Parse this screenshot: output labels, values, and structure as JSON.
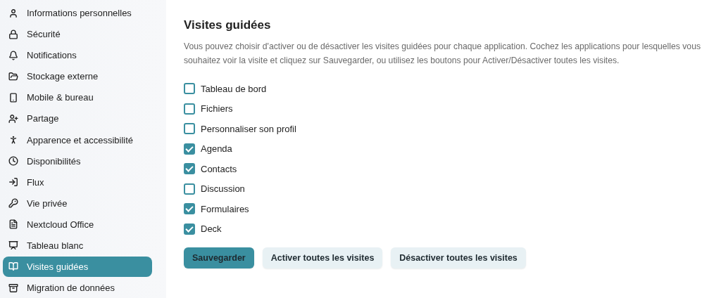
{
  "sidebar": {
    "items": [
      {
        "label": "Informations personnelles",
        "selected": false
      },
      {
        "label": "Sécurité",
        "selected": false
      },
      {
        "label": "Notifications",
        "selected": false
      },
      {
        "label": "Stockage externe",
        "selected": false
      },
      {
        "label": "Mobile & bureau",
        "selected": false
      },
      {
        "label": "Partage",
        "selected": false
      },
      {
        "label": "Apparence et accessibilité",
        "selected": false
      },
      {
        "label": "Disponibilités",
        "selected": false
      },
      {
        "label": "Flux",
        "selected": false
      },
      {
        "label": "Vie privée",
        "selected": false
      },
      {
        "label": "Nextcloud Office",
        "selected": false
      },
      {
        "label": "Tableau blanc",
        "selected": false
      },
      {
        "label": "Visites guidées",
        "selected": true
      },
      {
        "label": "Migration de données",
        "selected": false
      }
    ]
  },
  "main": {
    "title": "Visites guidées",
    "description": "Vous pouvez choisir d'activer ou de désactiver les visites guidées pour chaque application. Cochez les applications pour lesquelles vous souhaitez voir la visite et cliquez sur Sauvegarder, ou utilisez les boutons pour Activer/Désactiver toutes les visites.",
    "apps": [
      {
        "label": "Tableau de bord",
        "checked": false
      },
      {
        "label": "Fichiers",
        "checked": false
      },
      {
        "label": "Personnaliser son profil",
        "checked": false
      },
      {
        "label": "Agenda",
        "checked": true
      },
      {
        "label": "Contacts",
        "checked": true
      },
      {
        "label": "Discussion",
        "checked": false
      },
      {
        "label": "Formulaires",
        "checked": true
      },
      {
        "label": "Deck",
        "checked": true
      }
    ],
    "buttons": [
      {
        "label": "Sauvegarder",
        "kind": "primary"
      },
      {
        "label": "Activer toutes les visites",
        "kind": "secondary"
      },
      {
        "label": "Désactiver toutes les visites",
        "kind": "secondary"
      }
    ]
  }
}
